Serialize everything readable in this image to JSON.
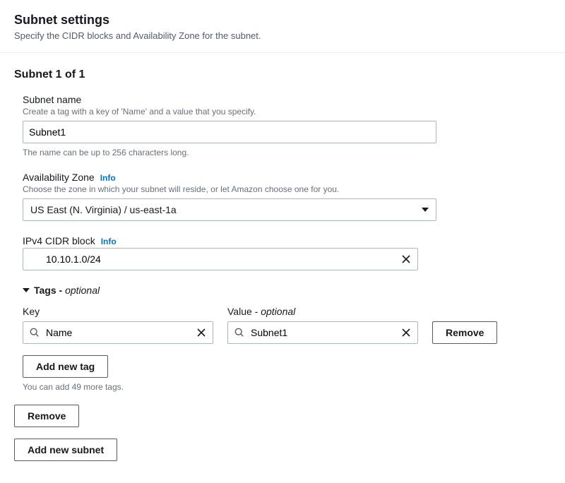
{
  "header": {
    "title": "Subnet settings",
    "subtitle": "Specify the CIDR blocks and Availability Zone for the subnet."
  },
  "subnet": {
    "counter": "Subnet 1 of 1",
    "name": {
      "label": "Subnet name",
      "help": "Create a tag with a key of 'Name' and a value that you specify.",
      "value": "Subnet1",
      "note": "The name can be up to 256 characters long."
    },
    "az": {
      "label": "Availability Zone",
      "info": "Info",
      "help": "Choose the zone in which your subnet will reside, or let Amazon choose one for you.",
      "value": "US East (N. Virginia) / us-east-1a"
    },
    "cidr": {
      "label": "IPv4 CIDR block",
      "info": "Info",
      "value": "10.10.1.0/24"
    },
    "tags": {
      "header": "Tags - ",
      "optional": "optional",
      "keyLabel": "Key",
      "valueLabel": "Value - ",
      "valueOptional": "optional",
      "rows": [
        {
          "key": "Name",
          "value": "Subnet1"
        }
      ],
      "removeLabel": "Remove",
      "addLabel": "Add new tag",
      "limitNote": "You can add 49 more tags."
    },
    "removeLabel": "Remove",
    "addSubnetLabel": "Add new subnet"
  }
}
